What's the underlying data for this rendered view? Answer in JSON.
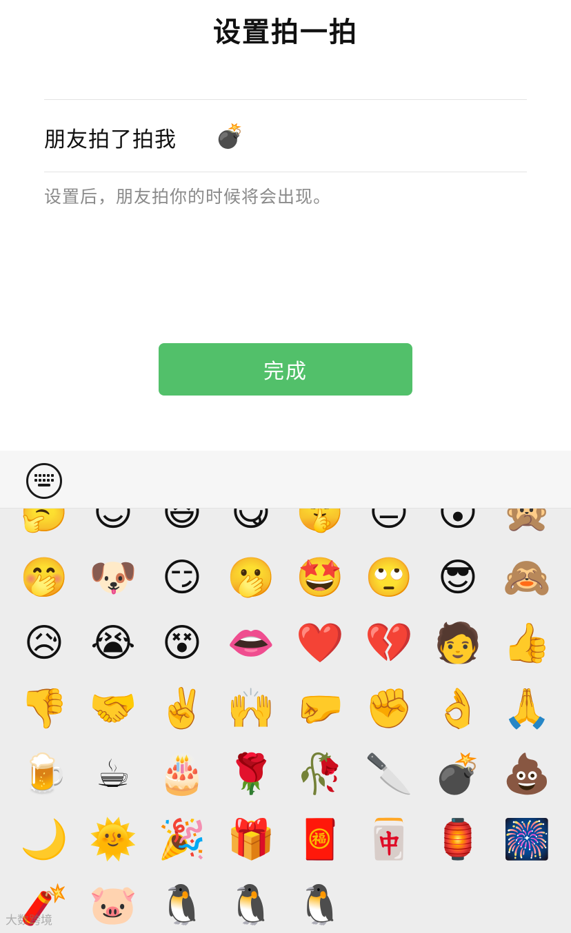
{
  "header": {
    "title": "设置拍一拍"
  },
  "setting": {
    "label": "朋友拍了拍我",
    "selected_emoji": "💣"
  },
  "hint": "设置后，朋友拍你的时候将会出现。",
  "done_button": {
    "label": "完成"
  },
  "toolbar": {
    "keyboard_icon": "keyboard-icon"
  },
  "emoji_rows": [
    [
      "🤔",
      "😊",
      "😆",
      "😋",
      "🤫",
      "😑",
      "😮",
      "🙊"
    ],
    [
      "🤭",
      "🐶",
      "😏",
      "🫢",
      "🤩",
      "🙄",
      "😎",
      "🙈"
    ],
    [
      "😥",
      "😭",
      "😵",
      "👄",
      "❤️",
      "💔",
      "🧑",
      "👍"
    ],
    [
      "👎",
      "🤝",
      "✌️",
      "🙌",
      "🤛",
      "✊",
      "👌",
      "🙏"
    ],
    [
      "🍺",
      "☕",
      "🎂",
      "🌹",
      "🥀",
      "🔪",
      "💣",
      "💩"
    ],
    [
      "🌙",
      "🌞",
      "🎉",
      "🎁",
      "🧧",
      "🀄",
      "🏮",
      "🎆"
    ],
    [
      "🧨",
      "🐷",
      "🐧",
      "🐧",
      "🐧"
    ]
  ],
  "emoji_names": [
    [
      "thinking-emoji",
      "smile-emoji",
      "grin-emoji",
      "watermelon-emoji",
      "shush-emoji",
      "neutral-emoji",
      "surprised-emoji",
      "speechless-emoji"
    ],
    [
      "smirk-emoji",
      "doge-emoji",
      "pensive-ok-emoji",
      "wave-emoji",
      "wow-emoji",
      "eye-roll-emoji",
      "666-emoji",
      "facepalm-emoji"
    ],
    [
      "sigh-emoji",
      "cry-emoji",
      "broken-emoji",
      "lips-emoji",
      "heart-emoji",
      "broken-heart-emoji",
      "figure-emoji",
      "thumbs-up-emoji"
    ],
    [
      "thumbs-down-emoji",
      "handshake-emoji",
      "victory-emoji",
      "salute-emoji",
      "beckon-emoji",
      "fist-emoji",
      "ok-emoji",
      "pray-emoji"
    ],
    [
      "beer-emoji",
      "coffee-emoji",
      "cake-emoji",
      "rose-emoji",
      "wilted-flower-emoji",
      "cleaver-emoji",
      "bomb-emoji",
      "poop-emoji"
    ],
    [
      "moon-emoji",
      "sun-emoji",
      "party-popper-emoji",
      "gift-emoji",
      "red-packet-emoji",
      "fa-tile-emoji",
      "fu-emoji",
      "fireworks-emoji"
    ],
    [
      "firecracker-emoji",
      "pig-emoji",
      "penguin-emoji",
      "penguin-dance-emoji",
      "penguin-emoji-2"
    ]
  ],
  "watermark": "大数跨境"
}
